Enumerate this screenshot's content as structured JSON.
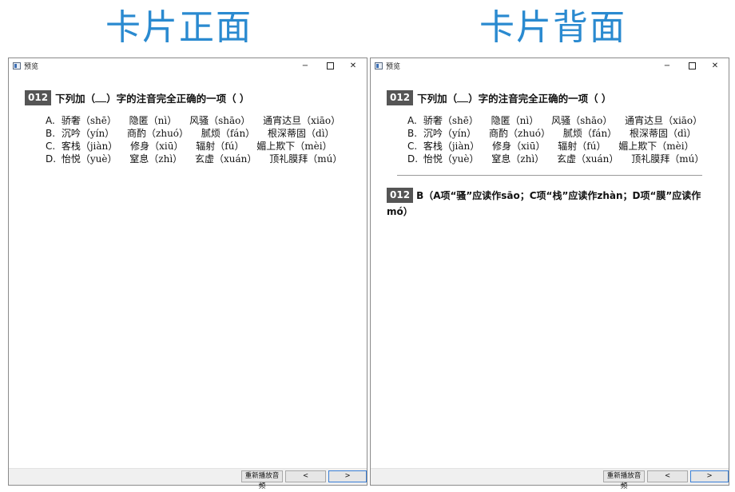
{
  "headings": {
    "front": "卡片正面",
    "back": "卡片背面"
  },
  "window": {
    "title": "预览",
    "minimize_glyph": "−",
    "close_glyph": "✕"
  },
  "question": {
    "number": "012",
    "text_before": "下列加（",
    "text_after": "）字的注音完全正确的一项（    ）",
    "options": [
      {
        "letter": "A.",
        "items": [
          "骄奢（shē）",
          "隐匿（nì）",
          "风骚（shāo）",
          "通宵达旦（xiāo）"
        ]
      },
      {
        "letter": "B.",
        "items": [
          "沉吟（yín）",
          "商酌（zhuó）",
          "腻烦（fán）",
          "根深蒂固（dì）"
        ]
      },
      {
        "letter": "C.",
        "items": [
          "客栈（jiàn）",
          "修身（xiū）",
          "辐射（fú）",
          "媚上欺下（mèi）"
        ]
      },
      {
        "letter": "D.",
        "items": [
          "怡悦（yuè）",
          "窒息（zhì）",
          "玄虚（xuán）",
          "顶礼膜拜（mú）"
        ]
      }
    ]
  },
  "answer": {
    "number": "012",
    "text": "B（A项“骚”应读作sāo；C项“栈”应读作zhàn；D项“膜”应读作mó）"
  },
  "bottom_bar": {
    "replay_label": "重新播放音频",
    "prev_label": "<",
    "next_label": ">"
  }
}
